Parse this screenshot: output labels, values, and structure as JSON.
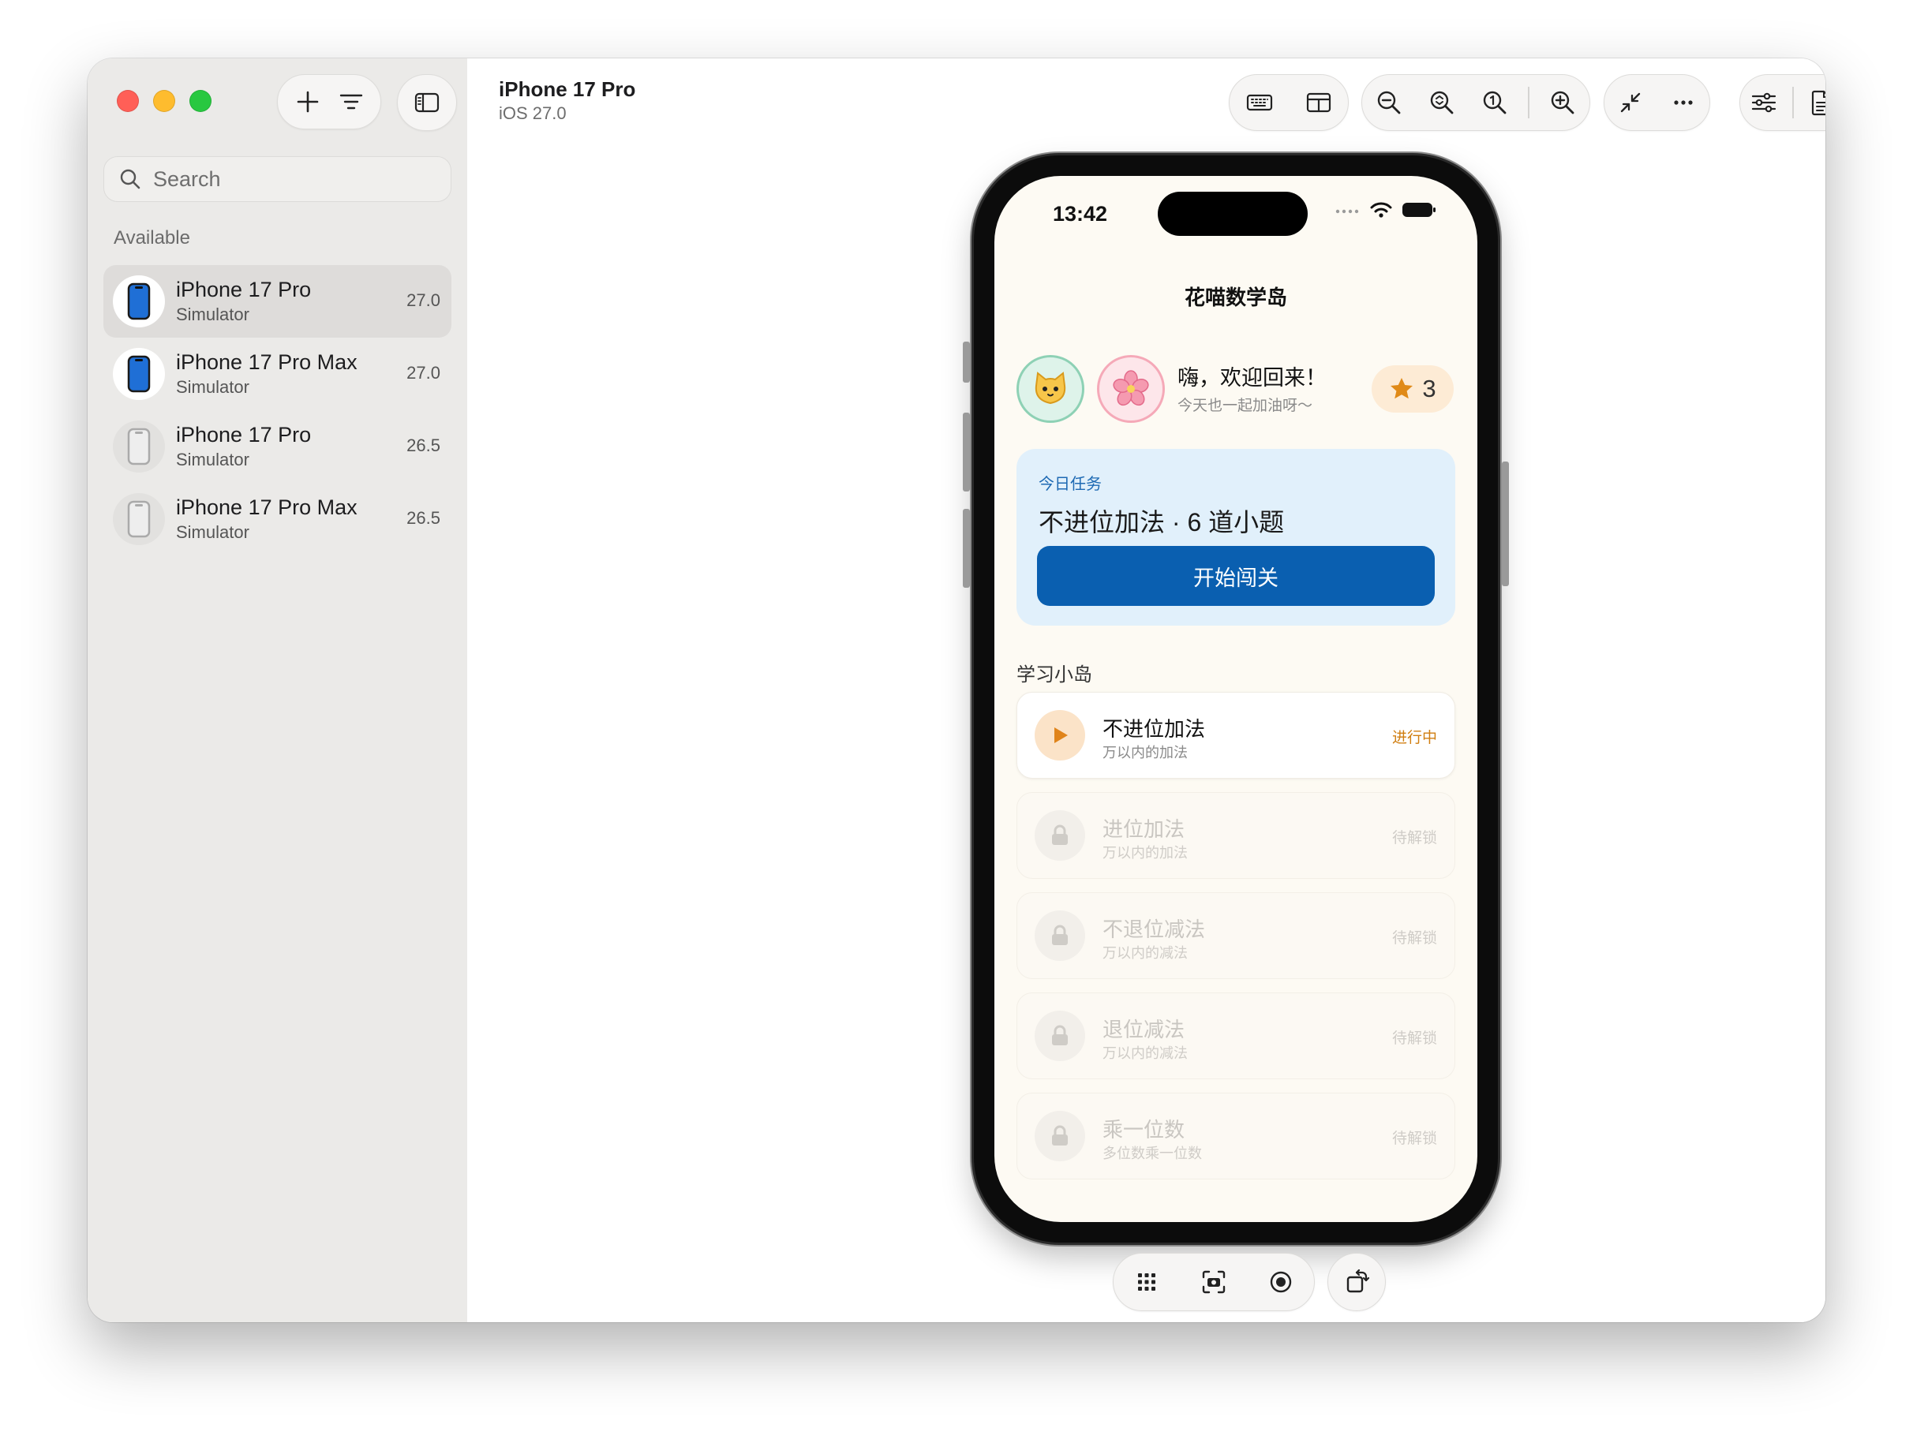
{
  "sidebar": {
    "search_placeholder": "Search",
    "section_label": "Available",
    "devices": [
      {
        "name": "iPhone 17 Pro",
        "type": "Simulator",
        "version": "27.0"
      },
      {
        "name": "iPhone 17 Pro Max",
        "type": "Simulator",
        "version": "27.0"
      },
      {
        "name": "iPhone 17 Pro",
        "type": "Simulator",
        "version": "26.5"
      },
      {
        "name": "iPhone 17 Pro Max",
        "type": "Simulator",
        "version": "26.5"
      }
    ]
  },
  "header": {
    "title": "iPhone 17 Pro",
    "subtitle": "iOS 27.0"
  },
  "phone": {
    "status_time": "13:42",
    "app_title": "花喵数学岛",
    "greeting": "嗨，欢迎回来！",
    "greeting_sub": "今天也一起加油呀～",
    "avatar_1": "🐱",
    "avatar_2": "🌸",
    "star_count": "3",
    "task": {
      "label": "今日任务",
      "title": "不进位加法 · 6 道小题",
      "button": "开始闯关"
    },
    "islands_label": "学习小岛",
    "lessons": [
      {
        "name": "不进位加法",
        "sub": "万以内的加法",
        "status": "进行中"
      },
      {
        "name": "进位加法",
        "sub": "万以内的加法",
        "status": "待解锁"
      },
      {
        "name": "不退位减法",
        "sub": "万以内的减法",
        "status": "待解锁"
      },
      {
        "name": "退位减法",
        "sub": "万以内的减法",
        "status": "待解锁"
      },
      {
        "name": "乘一位数",
        "sub": "多位数乘一位数",
        "status": "待解锁"
      }
    ]
  },
  "colors": {
    "accent_blue": "#0a5fb0",
    "in_progress_orange": "#d07e10",
    "sidebar_bg": "#ebeae8",
    "screen_bg": "#fdfaf3"
  },
  "icons": {
    "toolbar": [
      "keyboard-icon",
      "layout-icon",
      "zoom-out-icon",
      "zoom-fit-icon",
      "zoom-actual-icon",
      "zoom-in-icon",
      "shrink-icon",
      "more-icon",
      "settings-sliders-icon",
      "document-icon",
      "info-icon"
    ],
    "bottom": [
      "grid-icon",
      "screenshot-icon",
      "record-icon",
      "rotate-icon"
    ]
  }
}
